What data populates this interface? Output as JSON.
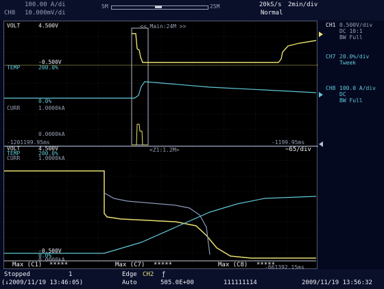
{
  "header": {
    "ch_a_label": "",
    "ch_a_scale": "100.00 A/di",
    "ch8_label": "CH8",
    "ch8_scale": "10.000mV/di",
    "record_left": "5M",
    "record_right": "25M",
    "sample_rate": "20kS/s",
    "time_div": "2min/div",
    "trigger_mode": "Normal"
  },
  "upper_window": {
    "volt_label": "VOLT",
    "volt_top": "4.500V",
    "volt_bottom": "-0.500V",
    "temp_label": "TEMP",
    "temp_top": "200.0%",
    "temp_bottom": "0.0%",
    "curr_label": "CURR",
    "curr_top": "1.0000kA",
    "curr_bottom": "0.0000kA",
    "zoom_label": "<< Main:24M >>",
    "time_left": "-1201199.95ms",
    "time_right": "-1199.95ms"
  },
  "lower_window": {
    "volt_label": "VOLT",
    "volt_top": "4.500V",
    "temp_label": "TEMP",
    "temp_top": "200.0%",
    "curr_label": "CURR",
    "curr_top": "1.0000kA",
    "volt_bottom": "-0.500V",
    "temp_bottom": "0.0%",
    "curr_bottom": "0.0000kA",
    "zoom_label": "<Z1:1.2M>",
    "zoom_div": "~65/div",
    "time_right": "-661392.15ms"
  },
  "measure": {
    "m1": "Max (C1)",
    "m1_val": "*****",
    "m2": "Max (C7)",
    "m2_val": "*****",
    "m3": "Max (C8)",
    "m3_val": "*****"
  },
  "channels": [
    {
      "id": "CH1",
      "scale": "0.500V/div",
      "coupling": "DC  10:1",
      "bw": "BW Full",
      "color": "#e8e070"
    },
    {
      "id": "CH7",
      "scale": "20.0%/div",
      "coupling": "Tweek",
      "bw": "",
      "color": "#60c8d8"
    },
    {
      "id": "CH8",
      "scale": "100.0 A/div",
      "coupling": "DC",
      "bw": "BW Full",
      "color": "#60c8d8"
    }
  ],
  "footer": {
    "status": "Stopped",
    "count": "1",
    "start_time": "(↓2009/11/19 13:46:05)",
    "trigger_type": "Edge",
    "trigger_ch": "CH2",
    "trigger_slope": "ƒ",
    "acq_mode": "Auto",
    "trigger_level": "505.0E+00",
    "channel_bits": "111111114",
    "clock": "2009/11/19 13:56:32"
  }
}
